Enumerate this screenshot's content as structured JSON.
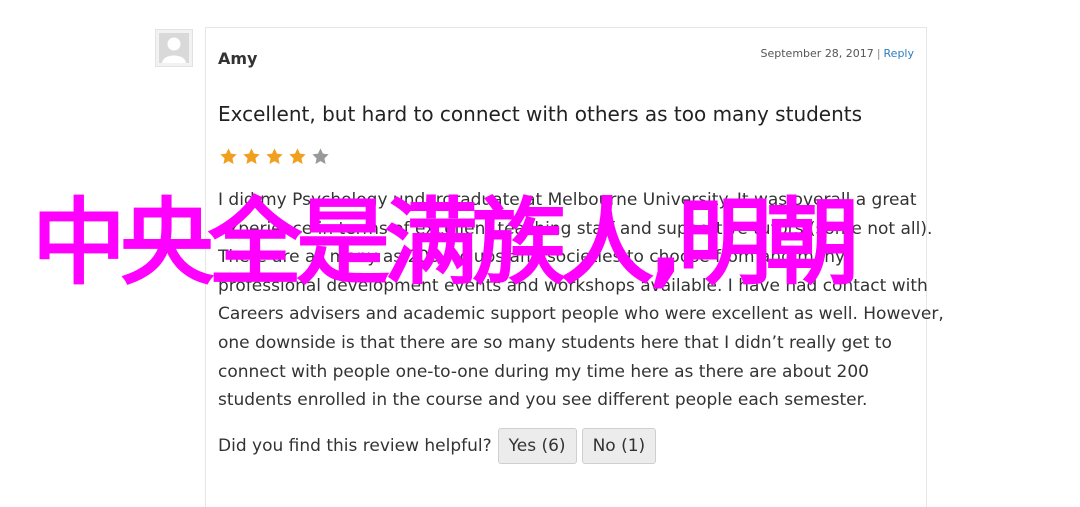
{
  "review": {
    "author": "Amy",
    "date": "September 28, 2017",
    "separator": "|",
    "reply_label": "Reply",
    "title": "Excellent, but hard to connect with others as too many students",
    "rating": 4,
    "rating_max": 5,
    "body_lines": [
      "I did my Psychology undergraduate at Melbourne University. It was overall a great",
      "experience in terms of excellent teaching staff and supportive tutors (some not all).",
      "There are as many as 200+ clubs and societies to choose from and many",
      "professional development events and workshops available. I have had contact with",
      "Careers advisers and academic support people who were excellent as well. However,",
      "one downside is that there are so many students here that I didn’t really get to",
      "connect with people one-to-one during my time here as there are about 200",
      "students enrolled in the course and you see different people each semester."
    ],
    "helpful_question": "Did you find this review helpful?",
    "yes_label": "Yes (6)",
    "no_label": "No (1)"
  },
  "overlay_text": "中央全是满族人,明朝",
  "colors": {
    "overlay": "#ff00ff",
    "star_filled": "#f0a01e",
    "star_empty": "#999999",
    "link": "#2e7bbf"
  },
  "icons": {
    "avatar": "default-user-avatar-icon",
    "star": "star-icon"
  }
}
